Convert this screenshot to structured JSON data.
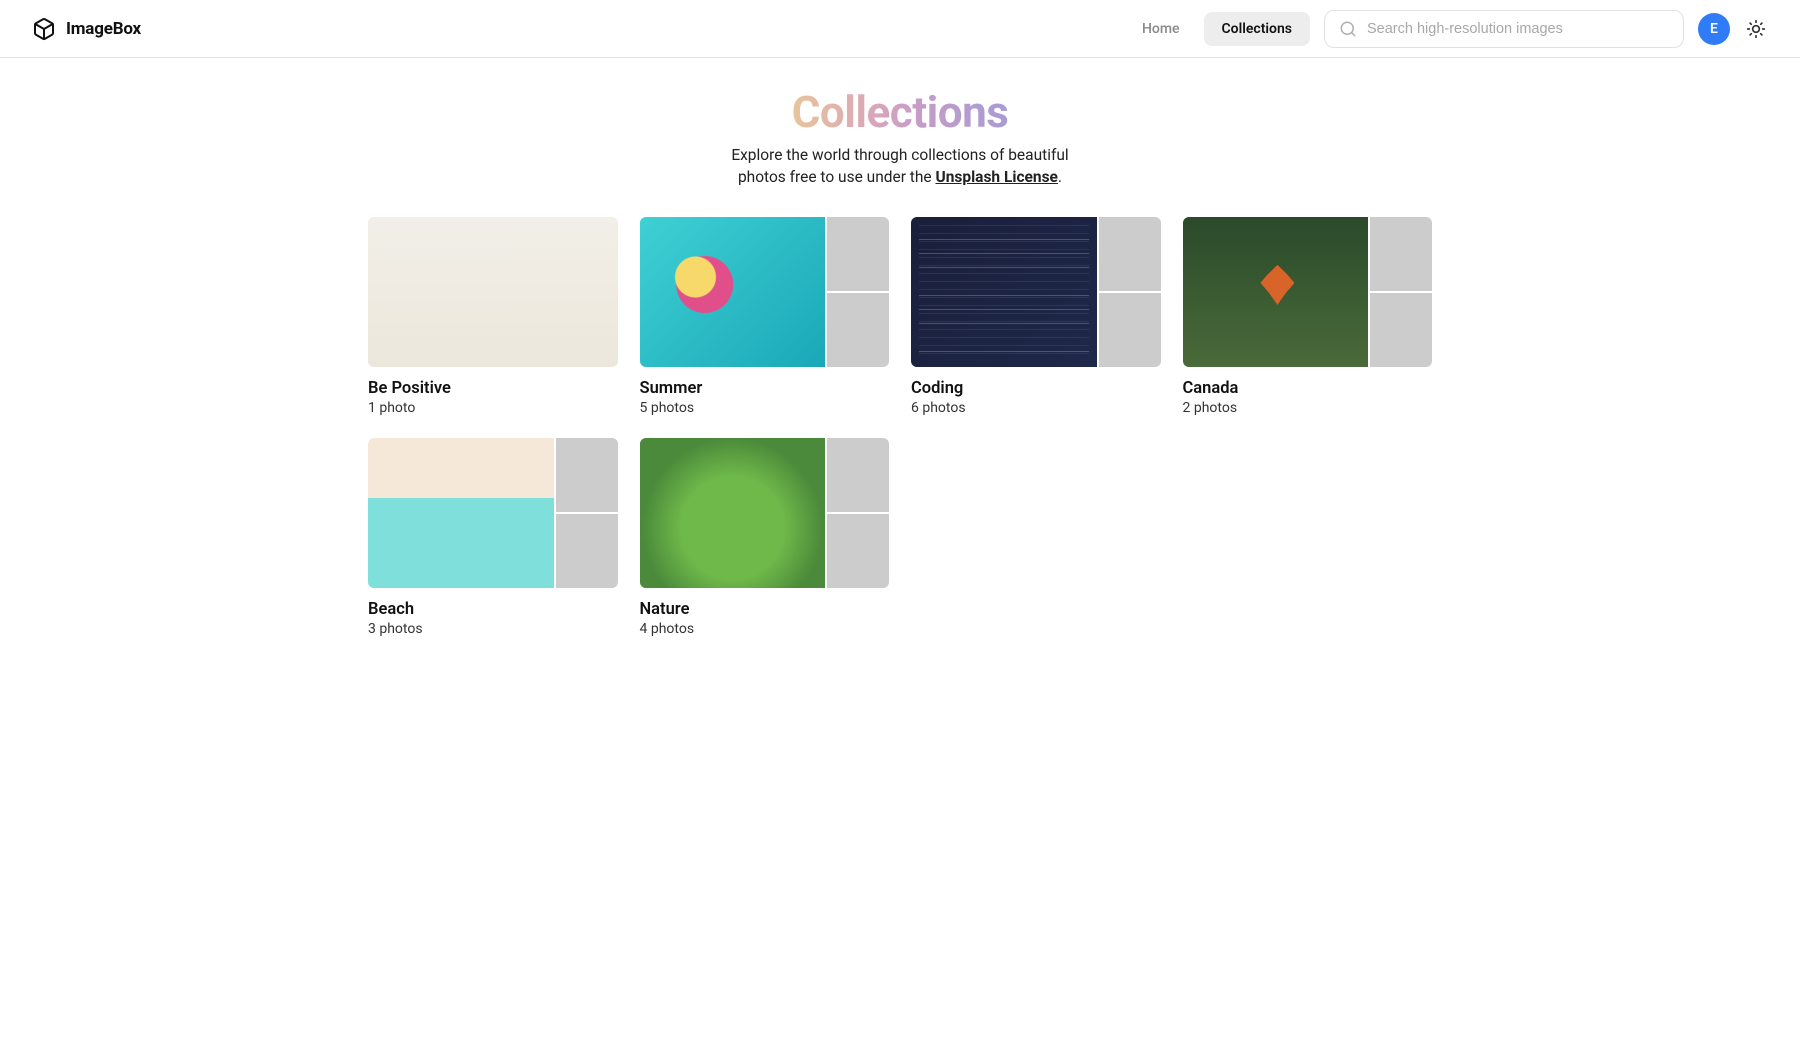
{
  "brand": "ImageBox",
  "nav": {
    "home": "Home",
    "collections": "Collections"
  },
  "search": {
    "placeholder": "Search high-resolution images"
  },
  "avatar_initial": "E",
  "page": {
    "title": "Collections",
    "subtitle_pre": "Explore the world through collections of beautiful",
    "subtitle_line2_pre": "photos free to use under the ",
    "license": "Unsplash License",
    "subtitle_suffix": "."
  },
  "collections": [
    {
      "title": "Be Positive",
      "count": "1 photo"
    },
    {
      "title": "Summer",
      "count": "5 photos"
    },
    {
      "title": "Coding",
      "count": "6 photos"
    },
    {
      "title": "Canada",
      "count": "2 photos"
    },
    {
      "title": "Beach",
      "count": "3 photos"
    },
    {
      "title": "Nature",
      "count": "4 photos"
    }
  ]
}
